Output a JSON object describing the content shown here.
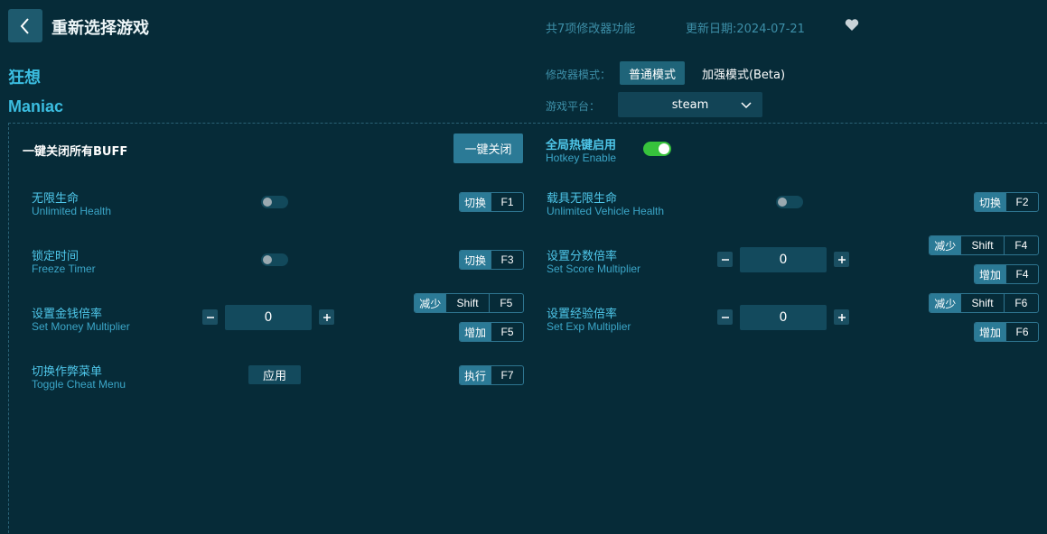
{
  "header": {
    "title": "重新选择游戏",
    "feature_count": "共7项修改器功能",
    "update_date": "更新日期:2024-07-21"
  },
  "game": {
    "name_cn": "狂想",
    "name_en": "Maniac"
  },
  "mode": {
    "label": "修改器模式：",
    "normal": "普通模式",
    "enhanced": "加强模式(Beta)",
    "selected": "普通模式"
  },
  "platform": {
    "label": "游戏平台：",
    "value": "steam"
  },
  "global": {
    "close_all_label": "一键关闭所有BUFF",
    "close_all_button": "一键关闭",
    "hotkey_cn": "全局热键启用",
    "hotkey_en": "Hotkey Enable",
    "hotkey_enabled": true
  },
  "features": {
    "unlimited_health": {
      "cn": "无限生命",
      "en": "Unlimited Health",
      "action": "切换",
      "key": "F1",
      "enabled": false
    },
    "freeze_timer": {
      "cn": "锁定时间",
      "en": "Freeze Timer",
      "action": "切换",
      "key": "F3",
      "enabled": false
    },
    "money_multiplier": {
      "cn": "设置金钱倍率",
      "en": "Set Money Multiplier",
      "value": "0",
      "dec_action": "减少",
      "dec_mod": "Shift",
      "dec_key": "F5",
      "inc_action": "增加",
      "inc_key": "F5"
    },
    "cheat_menu": {
      "cn": "切换作弊菜单",
      "en": "Toggle Cheat Menu",
      "button": "应用",
      "action": "执行",
      "key": "F7"
    },
    "vehicle_health": {
      "cn": "载具无限生命",
      "en": "Unlimited Vehicle Health",
      "action": "切换",
      "key": "F2",
      "enabled": false
    },
    "score_multiplier": {
      "cn": "设置分数倍率",
      "en": "Set Score Multiplier",
      "value": "0",
      "dec_action": "减少",
      "dec_mod": "Shift",
      "dec_key": "F4",
      "inc_action": "增加",
      "inc_key": "F4"
    },
    "exp_multiplier": {
      "cn": "设置经验倍率",
      "en": "Set Exp Multiplier",
      "value": "0",
      "dec_action": "减少",
      "dec_mod": "Shift",
      "dec_key": "F6",
      "inc_action": "增加",
      "inc_key": "F6"
    }
  },
  "colors": {
    "background": "#062b38",
    "accent": "#3bbde0",
    "toggle_on": "#37c23c",
    "key_action": "#2b7a96"
  },
  "icons": {
    "back": "chevron-left-icon",
    "favorite": "heart-icon",
    "dropdown": "chevron-down-icon",
    "minus": "minus-icon",
    "plus": "plus-icon"
  }
}
